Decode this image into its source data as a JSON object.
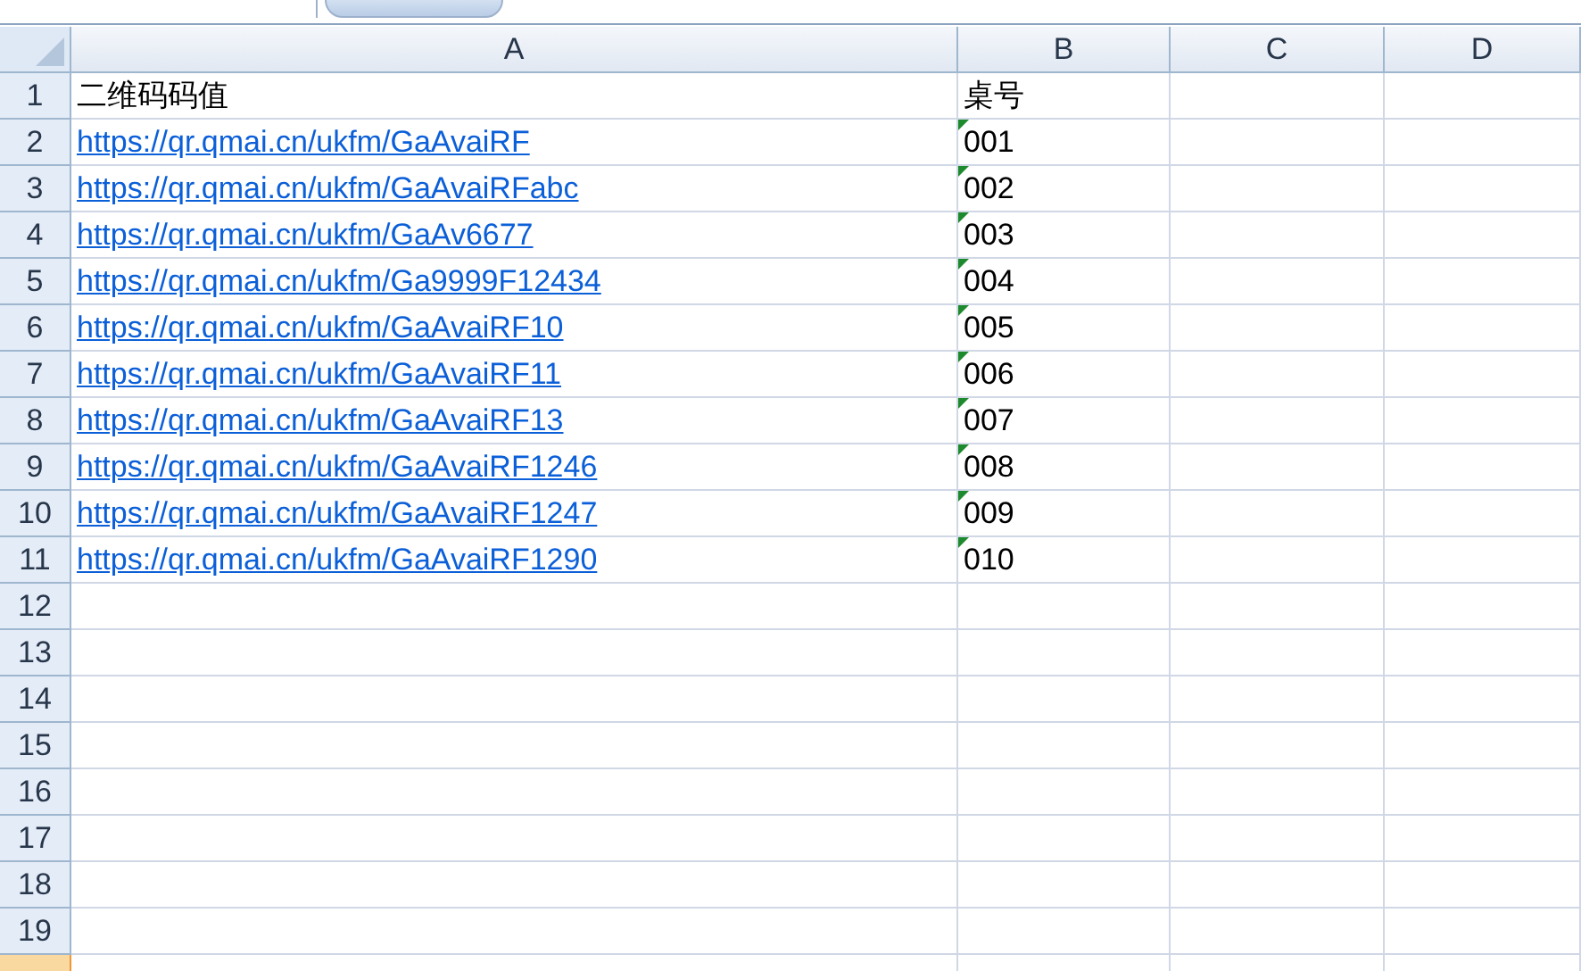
{
  "columns": [
    "A",
    "B",
    "C",
    "D"
  ],
  "rows": [
    {
      "number": "1",
      "selected": false,
      "cells": [
        {
          "text": "二维码码值",
          "kind": "text"
        },
        {
          "text": "桌号",
          "kind": "text",
          "flag": false
        }
      ]
    },
    {
      "number": "2",
      "selected": false,
      "cells": [
        {
          "text": "https://qr.qmai.cn/ukfm/GaAvaiRF",
          "kind": "link"
        },
        {
          "text": "001",
          "kind": "text",
          "flag": true
        }
      ]
    },
    {
      "number": "3",
      "selected": false,
      "cells": [
        {
          "text": "https://qr.qmai.cn/ukfm/GaAvaiRFabc",
          "kind": "link"
        },
        {
          "text": "002",
          "kind": "text",
          "flag": true
        }
      ]
    },
    {
      "number": "4",
      "selected": false,
      "cells": [
        {
          "text": "https://qr.qmai.cn/ukfm/GaAv6677",
          "kind": "link"
        },
        {
          "text": "003",
          "kind": "text",
          "flag": true
        }
      ]
    },
    {
      "number": "5",
      "selected": false,
      "cells": [
        {
          "text": "https://qr.qmai.cn/ukfm/Ga9999F12434",
          "kind": "link"
        },
        {
          "text": "004",
          "kind": "text",
          "flag": true
        }
      ]
    },
    {
      "number": "6",
      "selected": false,
      "cells": [
        {
          "text": "https://qr.qmai.cn/ukfm/GaAvaiRF10",
          "kind": "link"
        },
        {
          "text": "005",
          "kind": "text",
          "flag": true
        }
      ]
    },
    {
      "number": "7",
      "selected": false,
      "cells": [
        {
          "text": "https://qr.qmai.cn/ukfm/GaAvaiRF11",
          "kind": "link"
        },
        {
          "text": "006",
          "kind": "text",
          "flag": true
        }
      ]
    },
    {
      "number": "8",
      "selected": false,
      "cells": [
        {
          "text": "https://qr.qmai.cn/ukfm/GaAvaiRF13",
          "kind": "link"
        },
        {
          "text": "007",
          "kind": "text",
          "flag": true
        }
      ]
    },
    {
      "number": "9",
      "selected": false,
      "cells": [
        {
          "text": "https://qr.qmai.cn/ukfm/GaAvaiRF1246",
          "kind": "link"
        },
        {
          "text": "008",
          "kind": "text",
          "flag": true
        }
      ]
    },
    {
      "number": "10",
      "selected": false,
      "cells": [
        {
          "text": "https://qr.qmai.cn/ukfm/GaAvaiRF1247",
          "kind": "link"
        },
        {
          "text": "009",
          "kind": "text",
          "flag": true
        }
      ]
    },
    {
      "number": "11",
      "selected": false,
      "cells": [
        {
          "text": "https://qr.qmai.cn/ukfm/GaAvaiRF1290",
          "kind": "link"
        },
        {
          "text": "010",
          "kind": "text",
          "flag": true
        }
      ]
    },
    {
      "number": "12",
      "selected": false,
      "cells": []
    },
    {
      "number": "13",
      "selected": false,
      "cells": []
    },
    {
      "number": "14",
      "selected": false,
      "cells": []
    },
    {
      "number": "15",
      "selected": false,
      "cells": []
    },
    {
      "number": "16",
      "selected": false,
      "cells": []
    },
    {
      "number": "17",
      "selected": false,
      "cells": []
    },
    {
      "number": "18",
      "selected": false,
      "cells": []
    },
    {
      "number": "19",
      "selected": false,
      "cells": []
    }
  ],
  "cut_row": {
    "selected": true
  }
}
